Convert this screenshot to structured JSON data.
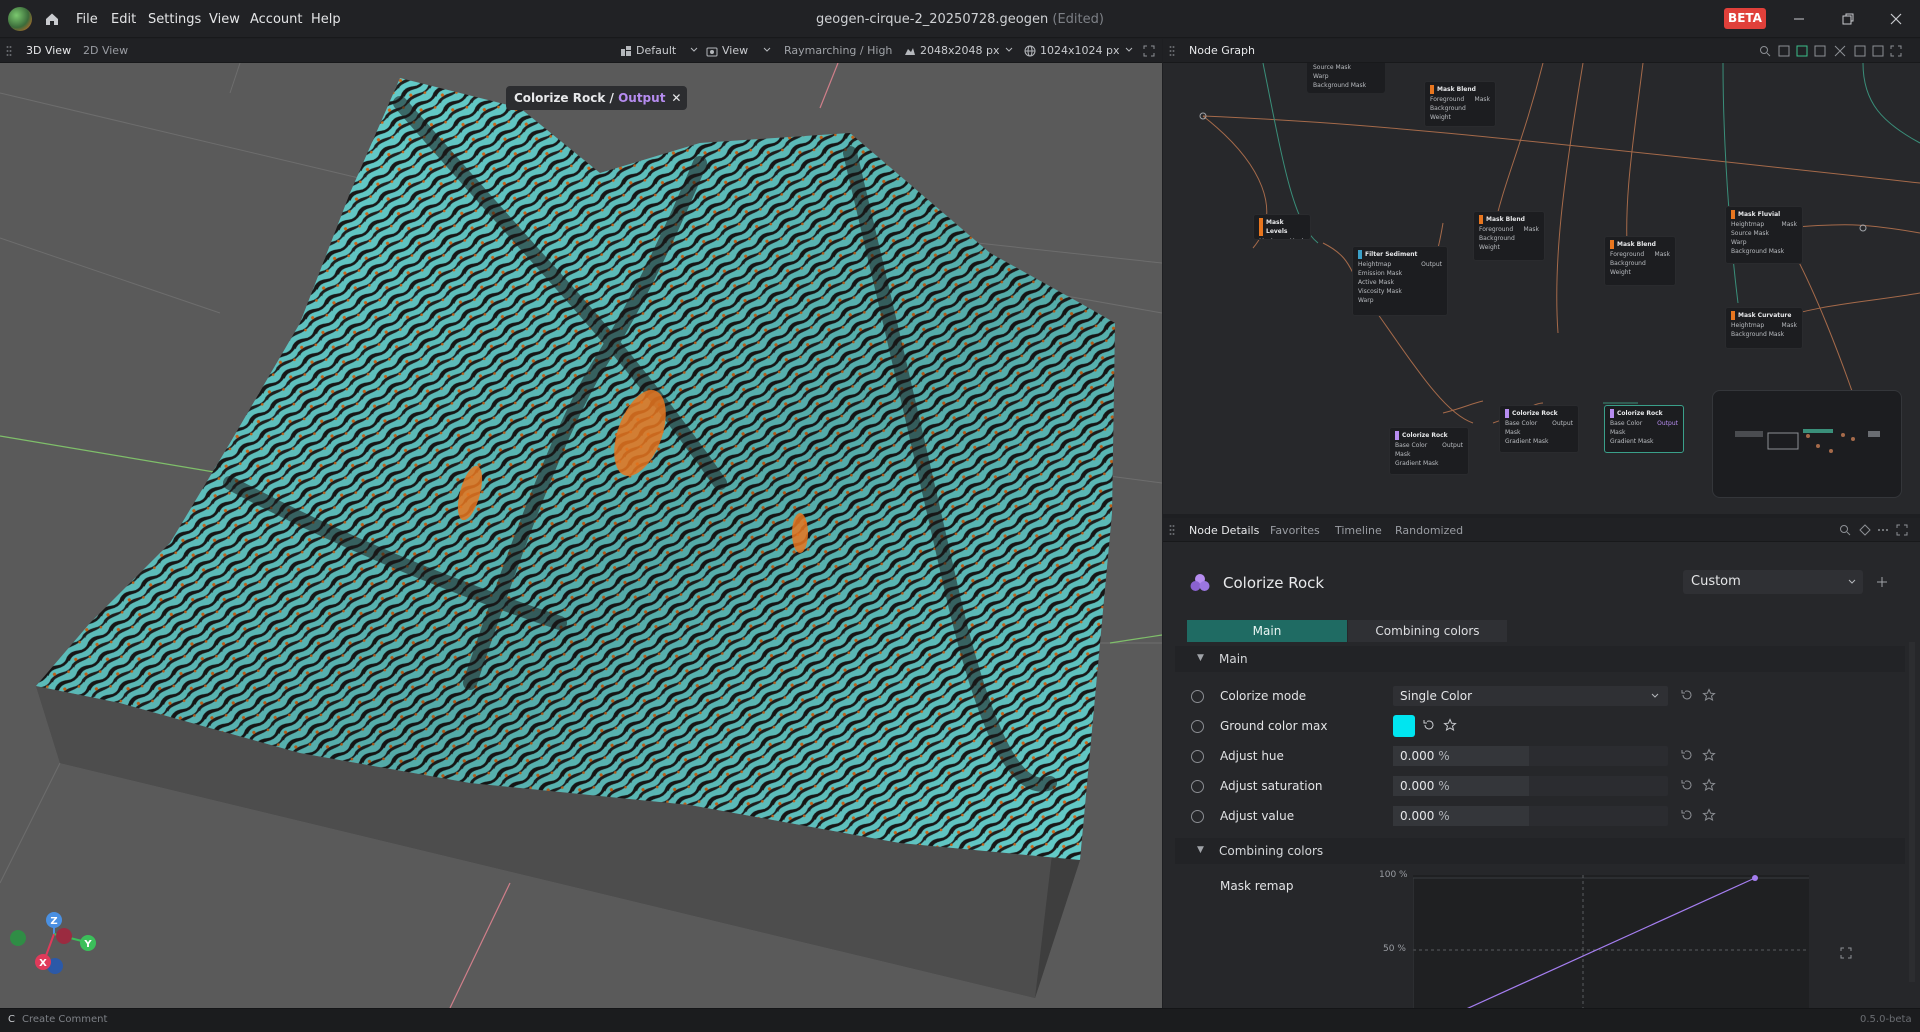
{
  "menu": [
    "File",
    "Edit",
    "Settings",
    "View",
    "Account",
    "Help"
  ],
  "doc": {
    "name": "geogen-cirque-2_20250728.geogen",
    "status": "(Edited)"
  },
  "beta": "BETA",
  "view_tabs": [
    "3D View",
    "2D View"
  ],
  "view_toolbar": {
    "layout": "Default",
    "view": "View",
    "render": "Raymarching / High",
    "heightmap_res": "2048x2048 px",
    "texture_res": "1024x1024 px"
  },
  "viewport_overlay": {
    "node": "Colorize Rock",
    "sep": " / ",
    "port": "Output"
  },
  "axes": {
    "z": "Z",
    "y": "Y",
    "x": "X"
  },
  "graph": {
    "title": "Node Graph",
    "nodes": [
      {
        "title": "Mask Blend",
        "ports": [
          "Foreground",
          "Background",
          "Weight"
        ],
        "out": "Mask"
      },
      {
        "title": "Mask Levels",
        "ports": [
          "Mask"
        ],
        "out": "Mask"
      },
      {
        "title": "Filter Sediment",
        "ports": [
          "Heightmap",
          "Emission Mask",
          "Active Mask",
          "Viscosity Mask",
          "Warp"
        ],
        "out": "Output"
      },
      {
        "title": "Mask Blend",
        "ports": [
          "Foreground",
          "Background",
          "Weight"
        ],
        "out": "Mask"
      },
      {
        "title": "Mask Blend",
        "ports": [
          "Foreground",
          "Background",
          "Weight"
        ],
        "out": "Mask"
      },
      {
        "title": "Mask Fluvial",
        "ports": [
          "Heightmap",
          "Source Mask",
          "Warp",
          "Background Mask"
        ],
        "out": "Mask"
      },
      {
        "title": "Mask Curvature",
        "ports": [
          "Heightmap",
          "Background Mask"
        ],
        "out": "Mask"
      },
      {
        "title": "Colorize Rock",
        "ports": [
          "Base Color",
          "Mask",
          "Gradient Mask"
        ],
        "out": "Output"
      },
      {
        "title": "Colorize Rock",
        "ports": [
          "Base Color",
          "Mask",
          "Gradient Mask"
        ],
        "out": "Output"
      },
      {
        "title": "Colorize Rock",
        "ports": [
          "Base Color",
          "Mask",
          "Gradient Mask"
        ],
        "out": "Output"
      }
    ],
    "partial_top": [
      "Source Mask",
      "Warp",
      "Background Mask"
    ]
  },
  "details_tabs": [
    "Node Details",
    "Favorites",
    "Timeline",
    "Randomized"
  ],
  "node": {
    "name": "Colorize Rock",
    "preset": "Custom",
    "tabs": [
      "Main",
      "Combining colors"
    ],
    "section_main": "Main",
    "params": [
      {
        "label": "Colorize mode",
        "value": "Single Color",
        "type": "select"
      },
      {
        "label": "Ground color max",
        "type": "color",
        "color": "#00e5f0"
      },
      {
        "label": "Adjust hue",
        "value": "0.000",
        "unit": "%",
        "type": "slider"
      },
      {
        "label": "Adjust saturation",
        "value": "0.000",
        "unit": "%",
        "type": "slider"
      },
      {
        "label": "Adjust value",
        "value": "0.000",
        "unit": "%",
        "type": "slider"
      }
    ],
    "section_combining": "Combining colors",
    "mask_remap": {
      "label": "Mask remap",
      "y100": "100 %",
      "y50": "50 %"
    }
  },
  "status": {
    "key": "C",
    "hint": "Create Comment",
    "version": "0.5.0-beta"
  },
  "colors": {
    "accent": "#1f6b63",
    "beta": "#e0403a",
    "port_output": "#b68cf0",
    "rock_cyan": "#6fe3e0",
    "rock_orange": "#e8761f"
  }
}
